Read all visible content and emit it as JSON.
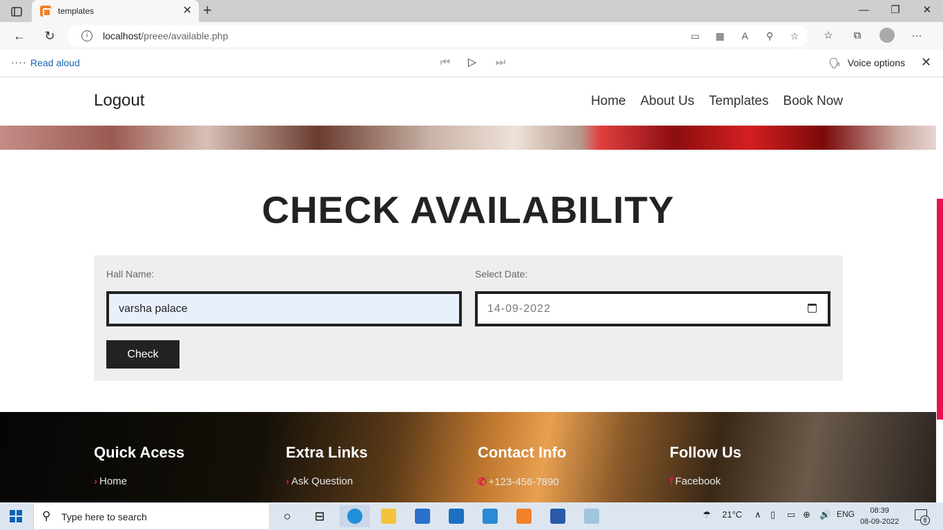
{
  "browser": {
    "tab_title": "templates",
    "url_host": "localhost",
    "url_path": "/preee/available.php",
    "new_tab": "+",
    "minimize": "—",
    "maximize": "❐",
    "close": "✕"
  },
  "read_aloud": {
    "label": "Read aloud",
    "voice_options": "Voice options"
  },
  "site": {
    "logo": "Logout",
    "menu": [
      "Home",
      "About Us",
      "Templates",
      "Book Now"
    ],
    "title": "CHECK AVAILABILITY",
    "form": {
      "hall_label": "Hall Name:",
      "hall_value": "varsha palace",
      "date_label": "Select Date:",
      "date_value": "14-09-2022",
      "button": "Check"
    },
    "footer": [
      {
        "heading": "Quick Acess",
        "link": "Home",
        "bullet": "›"
      },
      {
        "heading": "Extra Links",
        "link": "Ask Question",
        "bullet": "›"
      },
      {
        "heading": "Contact Info",
        "link": "+123-456-7890",
        "bullet": "✆"
      },
      {
        "heading": "Follow Us",
        "link": "Facebook",
        "bullet": "f"
      }
    ]
  },
  "taskbar": {
    "search_placeholder": "Type here to search",
    "temperature": "21°C",
    "language": "ENG",
    "time": "08:39",
    "date": "08-09-2022",
    "notification_count": "8"
  },
  "colors": {
    "accent": "#e8124f",
    "dark": "#222222",
    "link_blue": "#1a64b4"
  }
}
